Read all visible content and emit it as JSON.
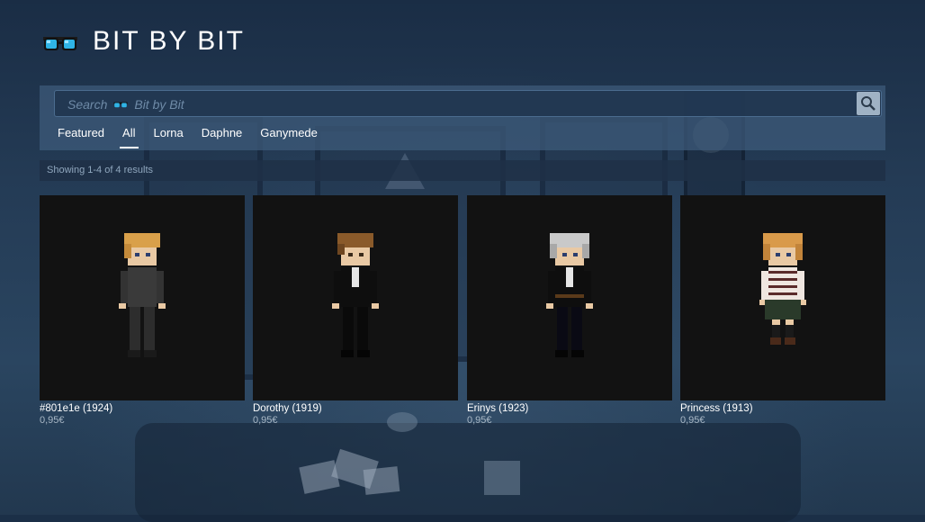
{
  "header": {
    "title": "BIT BY BIT",
    "logo_icon": "pixel-glasses-icon"
  },
  "search": {
    "placeholder": "Search",
    "placeholder_scope": "Bit by Bit",
    "button_icon": "magnifier-icon"
  },
  "tabs": [
    {
      "label": "Featured",
      "active": false
    },
    {
      "label": "All",
      "active": true
    },
    {
      "label": "Lorna",
      "active": false
    },
    {
      "label": "Daphne",
      "active": false
    },
    {
      "label": "Ganymede",
      "active": false
    }
  ],
  "results": {
    "text": "Showing 1-4 of 4 results"
  },
  "items": [
    {
      "name": "#801e1e (1924)",
      "price": "0,95€",
      "hair": "#d9a04a",
      "outfit": "dark-grey"
    },
    {
      "name": "Dorothy (1919)",
      "price": "0,95€",
      "hair": "#8a5a2a",
      "outfit": "black-suit"
    },
    {
      "name": "Erinys (1923)",
      "price": "0,95€",
      "hair": "#c9c9c9",
      "outfit": "black-suit"
    },
    {
      "name": "Princess (1913)",
      "price": "0,95€",
      "hair": "#d99a4a",
      "outfit": "striped-sweater"
    }
  ],
  "colors": {
    "accent": "#ffffff",
    "panel": "#3e5c7c",
    "card_bg": "#121212",
    "price_text": "#a9b8c6"
  }
}
